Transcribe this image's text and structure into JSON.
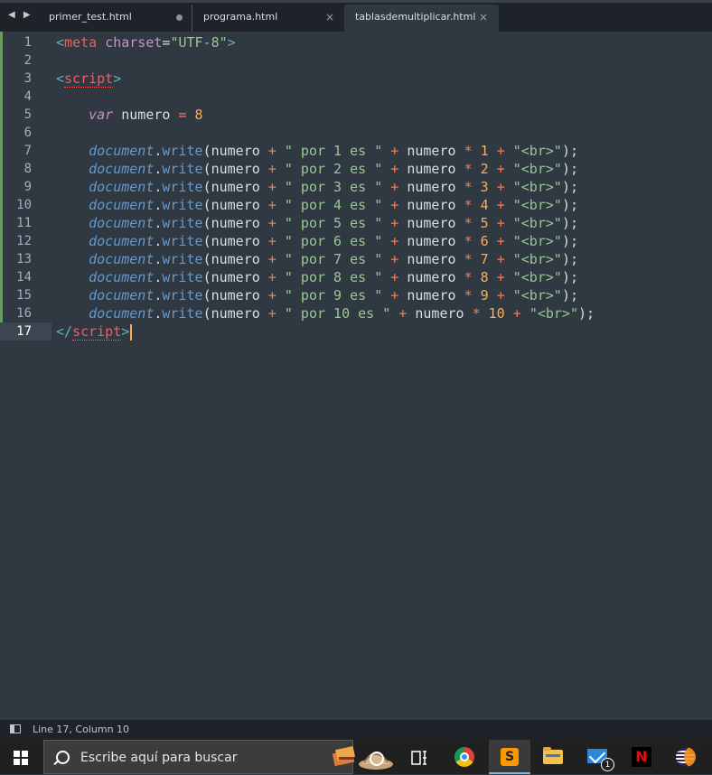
{
  "tabs": [
    {
      "label": "primer_test.html",
      "control": "dot"
    },
    {
      "label": "programa.html",
      "control": "×"
    },
    {
      "label": "tablasdemultiplicar.html",
      "control": "×"
    }
  ],
  "nav_arrows": "◀ ▶",
  "line_numbers": [
    "1",
    "2",
    "3",
    "4",
    "5",
    "6",
    "7",
    "8",
    "9",
    "10",
    "11",
    "12",
    "13",
    "14",
    "15",
    "16",
    "17"
  ],
  "code": {
    "l1": {
      "open": "<",
      "tag": "meta",
      "attr": "charset",
      "eq": "=",
      "val": "\"UTF-8\"",
      "close": ">"
    },
    "l3": {
      "open": "<",
      "tag": "script",
      "close": ">"
    },
    "l5": {
      "kw": "var",
      "name": "numero",
      "op": "=",
      "num": "8"
    },
    "writes": [
      {
        "obj": "document",
        "fn": "write",
        "pre": "(numero ",
        "p1": "+",
        "s1": "\" por 1 es \"",
        "p2": "+",
        "mid": " numero ",
        "m": "*",
        "n": "1",
        "p3": "+",
        "s2": "\"<br>\"",
        "end": ");"
      },
      {
        "obj": "document",
        "fn": "write",
        "pre": "(numero ",
        "p1": "+",
        "s1": "\" por 2 es \"",
        "p2": "+",
        "mid": " numero ",
        "m": "*",
        "n": "2",
        "p3": "+",
        "s2": "\"<br>\"",
        "end": ");"
      },
      {
        "obj": "document",
        "fn": "write",
        "pre": "(numero ",
        "p1": "+",
        "s1": "\" por 3 es \"",
        "p2": "+",
        "mid": " numero ",
        "m": "*",
        "n": "3",
        "p3": "+",
        "s2": "\"<br>\"",
        "end": ");"
      },
      {
        "obj": "document",
        "fn": "write",
        "pre": "(numero ",
        "p1": "+",
        "s1": "\" por 4 es \"",
        "p2": "+",
        "mid": " numero ",
        "m": "*",
        "n": "4",
        "p3": "+",
        "s2": "\"<br>\"",
        "end": ");"
      },
      {
        "obj": "document",
        "fn": "write",
        "pre": "(numero ",
        "p1": "+",
        "s1": "\" por 5 es \"",
        "p2": "+",
        "mid": " numero ",
        "m": "*",
        "n": "5",
        "p3": "+",
        "s2": "\"<br>\"",
        "end": ");"
      },
      {
        "obj": "document",
        "fn": "write",
        "pre": "(numero ",
        "p1": "+",
        "s1": "\" por 6 es \"",
        "p2": "+",
        "mid": " numero ",
        "m": "*",
        "n": "6",
        "p3": "+",
        "s2": "\"<br>\"",
        "end": ");"
      },
      {
        "obj": "document",
        "fn": "write",
        "pre": "(numero ",
        "p1": "+",
        "s1": "\" por 7 es \"",
        "p2": "+",
        "mid": " numero ",
        "m": "*",
        "n": "7",
        "p3": "+",
        "s2": "\"<br>\"",
        "end": ");"
      },
      {
        "obj": "document",
        "fn": "write",
        "pre": "(numero ",
        "p1": "+",
        "s1": "\" por 8 es \"",
        "p2": "+",
        "mid": " numero ",
        "m": "*",
        "n": "8",
        "p3": "+",
        "s2": "\"<br>\"",
        "end": ");"
      },
      {
        "obj": "document",
        "fn": "write",
        "pre": "(numero ",
        "p1": "+",
        "s1": "\" por 9 es \"",
        "p2": "+",
        "mid": " numero ",
        "m": "*",
        "n": "9",
        "p3": "+",
        "s2": "\"<br>\"",
        "end": ");"
      },
      {
        "obj": "document",
        "fn": "write",
        "pre": "(numero ",
        "p1": "+",
        "s1": "\" por 10 es \"",
        "p2": "+",
        "mid": " numero ",
        "m": "*",
        "n": "10",
        "p3": "+",
        "s2": "\"<br>\"",
        "end": ");"
      }
    ],
    "l17": {
      "open": "</",
      "tag": "script",
      "close": ">"
    }
  },
  "status": {
    "position": "Line 17, Column 10"
  },
  "taskbar": {
    "search_placeholder": "Escribe aquí para buscar",
    "mail_badge": "1",
    "netflix_letter": "N",
    "sublime_letter": "S"
  },
  "colors": {
    "editor_bg": "#303841",
    "tag": "#ec5f67",
    "string": "#99c794",
    "number": "#f9ae58",
    "operator": "#f97b58",
    "object": "#6699cc"
  }
}
